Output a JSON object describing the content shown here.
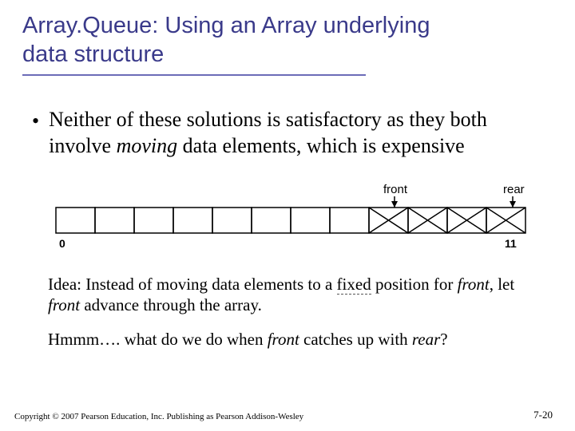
{
  "title": {
    "line1": "Array.Queue: Using an Array underlying",
    "line2": "data structure"
  },
  "bullet": {
    "pre": "Neither of these solutions is satisfactory as they both involve ",
    "emph": "moving",
    "post": " data elements, which is expensive"
  },
  "diagram": {
    "labels": {
      "front": "front",
      "rear": "rear"
    },
    "indices": {
      "start": "0",
      "end": "11"
    },
    "cells": 12,
    "filled_start": 8,
    "filled_end": 11
  },
  "idea": {
    "t1": "Idea: Instead of moving data elements to a ",
    "fixed": "fixed",
    "t2": " position for ",
    "front": "front",
    "t3": ", let ",
    "front2": "front",
    "t4": " advance through the array."
  },
  "hmmm": {
    "t1": "Hmmm…. what do we do when ",
    "front": "front",
    "t2": " catches up with ",
    "rear": "rear",
    "t3": "?"
  },
  "footer": {
    "left": "Copyright © 2007 Pearson Education, Inc. Publishing as Pearson Addison-Wesley",
    "right": "7-20"
  }
}
